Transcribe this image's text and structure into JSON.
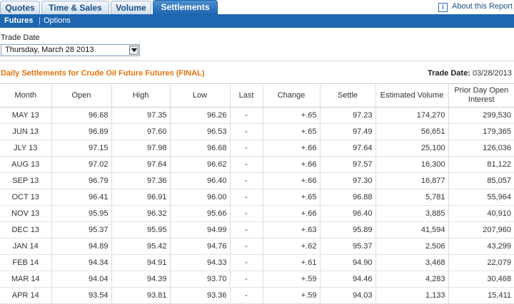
{
  "tabs": [
    "Quotes",
    "Time & Sales",
    "Volume",
    "Settlements"
  ],
  "about": "About this Report",
  "subnav": {
    "futures": "Futures",
    "separator": "|",
    "options": "Options"
  },
  "trade_date_label": "Trade Date",
  "trade_date_value": "Thursday, March 28 2013",
  "report_title": "Daily Settlements for Crude Oil Future Futures (FINAL)",
  "trade_date_header": {
    "label": "Trade Date:",
    "value": "03/28/2013"
  },
  "columns": [
    "Month",
    "Open",
    "High",
    "Low",
    "Last",
    "Change",
    "Settle",
    "Estimated Volume",
    "Prior Day Open Interest"
  ],
  "rows": [
    [
      "MAY 13",
      "96.68",
      "97.35",
      "96.26",
      "-",
      "+.65",
      "97.23",
      "174,270",
      "299,530"
    ],
    [
      "JUN 13",
      "96.89",
      "97.60",
      "96.53",
      "-",
      "+.65",
      "97.49",
      "56,651",
      "179,365"
    ],
    [
      "JLY 13",
      "97.15",
      "97.98",
      "96.68",
      "-",
      "+.66",
      "97.64",
      "25,100",
      "126,036"
    ],
    [
      "AUG 13",
      "97.02",
      "97.64",
      "96.62",
      "-",
      "+.66",
      "97.57",
      "16,300",
      "81,122"
    ],
    [
      "SEP 13",
      "96.79",
      "97.36",
      "96.40",
      "-",
      "+.66",
      "97.30",
      "16,877",
      "85,057"
    ],
    [
      "OCT 13",
      "96.41",
      "96.91",
      "96.00",
      "-",
      "+.65",
      "96.88",
      "5,781",
      "55,964"
    ],
    [
      "NOV 13",
      "95.95",
      "96.32",
      "95.66",
      "-",
      "+.66",
      "96.40",
      "3,885",
      "40,910"
    ],
    [
      "DEC 13",
      "95.37",
      "95.95",
      "94.99",
      "-",
      "+.63",
      "95.89",
      "41,594",
      "207,960"
    ],
    [
      "JAN 14",
      "94.89",
      "95.42",
      "94.76",
      "-",
      "+.62",
      "95.37",
      "2,506",
      "43,299"
    ],
    [
      "FEB 14",
      "94.34",
      "94.91",
      "94.33",
      "-",
      "+.61",
      "94.90",
      "3,468",
      "22,079"
    ],
    [
      "MAR 14",
      "94.04",
      "94.39",
      "93.70",
      "-",
      "+.59",
      "94.46",
      "4,283",
      "30,468"
    ],
    [
      "APR 14",
      "93.54",
      "93.81",
      "93.36",
      "-",
      "+.59",
      "94.03",
      "1,133",
      "15,411"
    ]
  ]
}
